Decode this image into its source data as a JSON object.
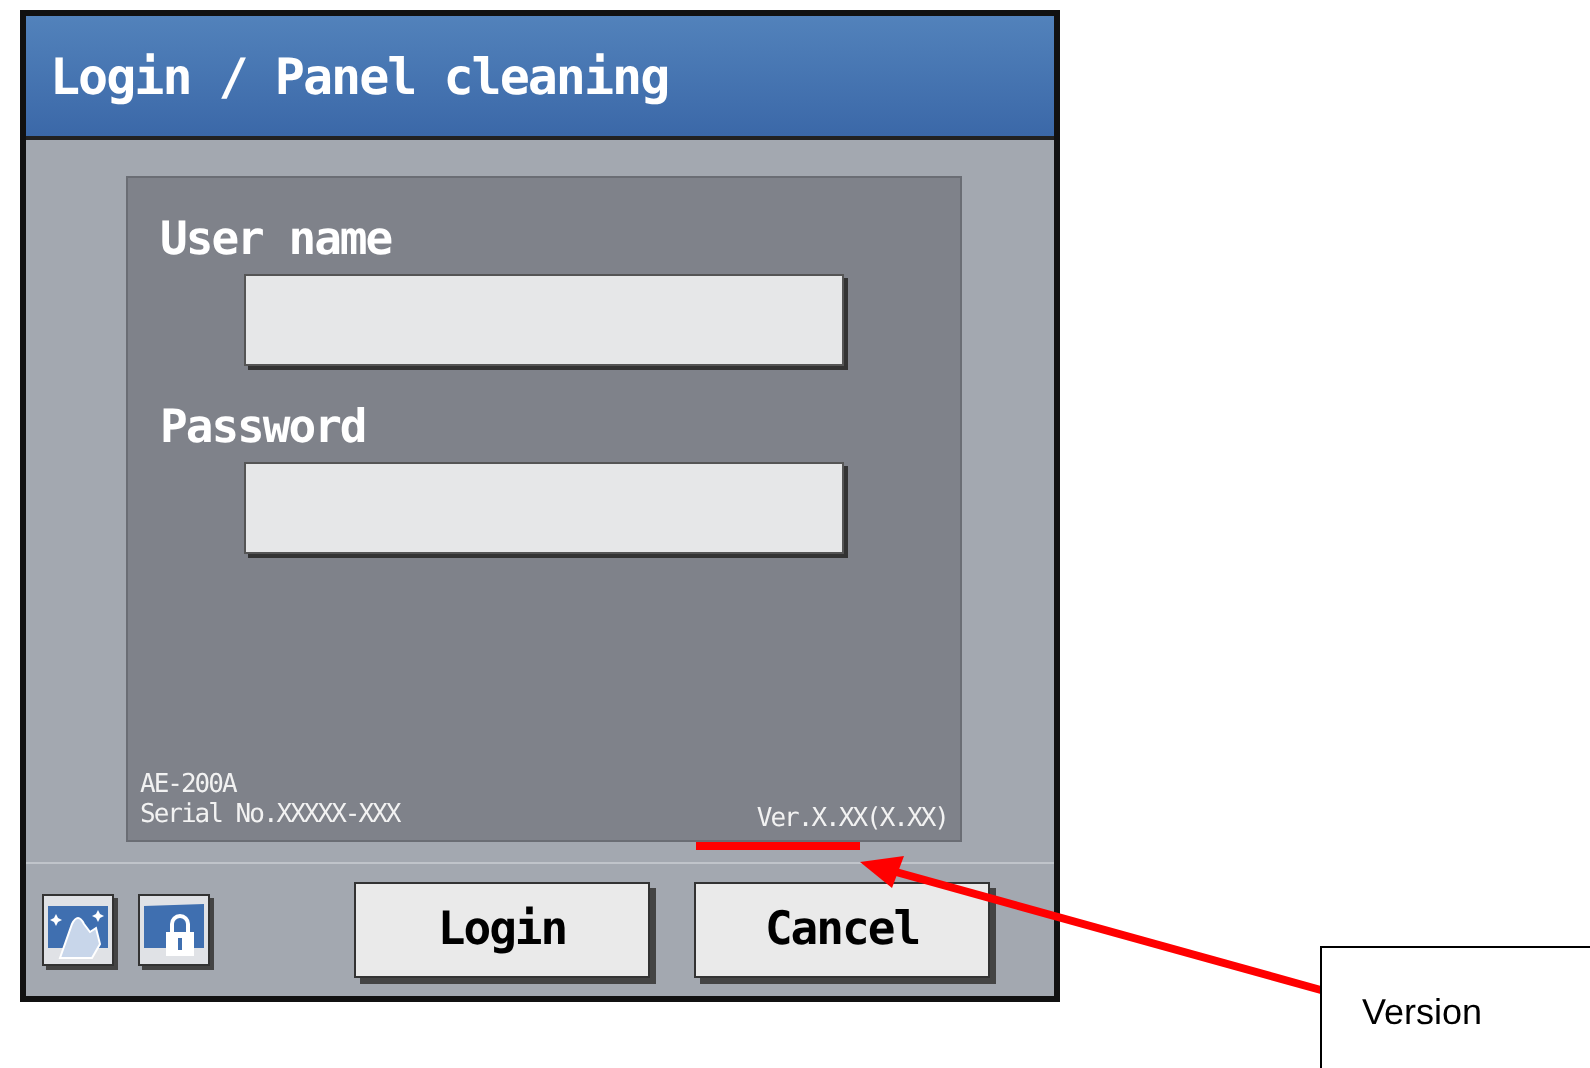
{
  "window": {
    "title": "Login / Panel cleaning"
  },
  "fields": [
    {
      "label": "User name"
    },
    {
      "label": "Password"
    }
  ],
  "device": {
    "model": "AE-200A",
    "serial": "Serial No.XXXXX-XXX",
    "version": "Ver.X.XX",
    "version_detail": "(X.XX)"
  },
  "buttons": [
    "Login",
    "Cancel"
  ],
  "callout": {
    "text": "Version"
  }
}
